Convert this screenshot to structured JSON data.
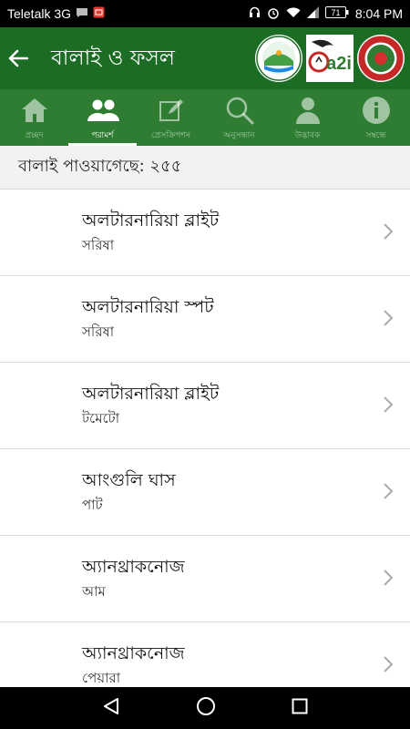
{
  "status": {
    "carrier": "Teletalk 3G",
    "battery": "71",
    "time": "8:04 PM"
  },
  "app_bar": {
    "title": "বালাই ও ফসল",
    "logos": [
      "govt-agency-logo",
      "a2i-logo",
      "bangladesh-govt-logo"
    ],
    "a2i_text": "a2i"
  },
  "tabs": [
    {
      "label": "প্রচ্ছদ",
      "icon": "home-icon",
      "active": false
    },
    {
      "label": "পরামর্শ",
      "icon": "people-icon",
      "active": true
    },
    {
      "label": "প্রেসক্রিপশন",
      "icon": "prescription-icon",
      "active": false
    },
    {
      "label": "অনুসন্ধান",
      "icon": "search-icon",
      "active": false
    },
    {
      "label": "উদ্ভাবক",
      "icon": "person-icon",
      "active": false
    },
    {
      "label": "সম্বন্ধে",
      "icon": "info-icon",
      "active": false
    }
  ],
  "count_text": "বালাই পাওয়াগেছে: ২৫৫",
  "items": [
    {
      "title": "অলটারনারিয়া ব্লাইট",
      "sub": "সরিষা"
    },
    {
      "title": "অলটারনারিয়া স্পট",
      "sub": "সরিষা"
    },
    {
      "title": "অলটারনারিয়া ব্লাইট",
      "sub": "টমেটো"
    },
    {
      "title": "আংগুলি ঘাস",
      "sub": "পাট"
    },
    {
      "title": "অ্যানথ্রাকনোজ",
      "sub": "আম"
    },
    {
      "title": "অ্যানথ্রাকনোজ",
      "sub": "পেয়ারা"
    }
  ],
  "colors": {
    "app_bar": "#1b6d24",
    "tabs": "#2e7d32"
  }
}
